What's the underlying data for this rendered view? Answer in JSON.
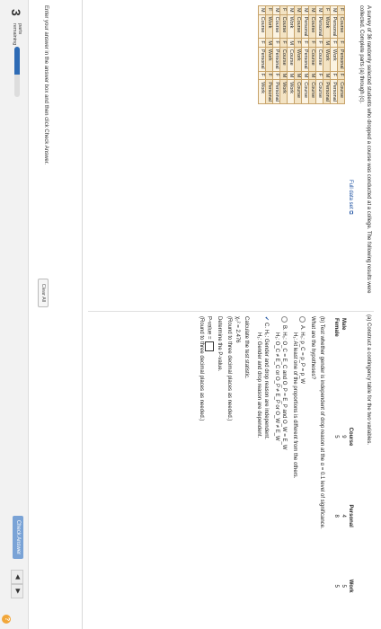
{
  "problem": {
    "intro": "A survey of 36 randomly selected students who dropped a course was conducted at a college. The following results were collected. Complete parts (a) through (c).",
    "full_data_label": "Full data set",
    "data_rows": [
      [
        "F",
        "Course",
        "F",
        "Personal",
        "F",
        "Course"
      ],
      [
        "M",
        "Personal",
        "F",
        "Work",
        "F",
        "Personal"
      ],
      [
        "F",
        "Work",
        "M",
        "Work",
        "M",
        "Personal"
      ],
      [
        "M",
        "Personal",
        "F",
        "Course",
        "F",
        "Course"
      ],
      [
        "M",
        "Course",
        "F",
        "Course",
        "M",
        "Course"
      ],
      [
        "M",
        "Personal",
        "F",
        "Personal",
        "M",
        "Course"
      ],
      [
        "M",
        "Course",
        "F",
        "Work",
        "M",
        "Course"
      ],
      [
        "M",
        "Work",
        "M",
        "Course",
        "M",
        "Work"
      ],
      [
        "F",
        "Course",
        "F",
        "Course",
        "M",
        "Work"
      ],
      [
        "M",
        "Course",
        "F",
        "Personal",
        "F",
        "Personal"
      ],
      [
        "F",
        "Work",
        "M",
        "Work",
        "F",
        "Personal"
      ],
      [
        "M",
        "Course",
        "F",
        "Personal",
        "F",
        "Work"
      ]
    ]
  },
  "part_a": {
    "prompt": "(a) Construct a contingency table for the two variables.",
    "columns": [
      "Course",
      "Personal",
      "Work"
    ],
    "rows": [
      {
        "label": "Male",
        "values": [
          "9",
          "4",
          "5"
        ]
      },
      {
        "label": "Female",
        "values": [
          "5",
          "8",
          "5"
        ]
      }
    ]
  },
  "part_b": {
    "prompt": "(b) Test whether gender is independent of drop reason at the α = 0.1 level of significance.",
    "question": "What are the hypotheses?",
    "options": [
      {
        "letter": "A.",
        "line1": "H₀: p_C = p_P = p_W",
        "line2": "H₁: At least one of the proportions is different from the others."
      },
      {
        "letter": "B.",
        "line1": "H₀: O_C = E_C and O_P = E_P and O_W = E_W",
        "line2": "H₁: O_C ≠ E_C or O_P ≠ E_P or O_W ≠ E_W"
      },
      {
        "letter": "C.",
        "line1": "H₀: Gender and drop reason are independent.",
        "line2": "H₁: Gender and drop reason are dependent."
      }
    ],
    "selected": "C.",
    "test_stat_label": "Calculate the test statistic.",
    "chi_value": "χ₀² = 2.476",
    "round_note_1": "(Round to three decimal places as needed.)",
    "pvalue_prompt": "Determine the P-value.",
    "pvalue_label": "P-value =",
    "round_note_2": "(Round to three decimal places as needed.)"
  },
  "footer": {
    "hint": "Enter your answer in the answer box and then click Check Answer.",
    "clear_all": "Clear All",
    "parts_count": "3",
    "parts_label_1": "parts",
    "parts_label_2": "remaining",
    "progress": 0.55,
    "check_answer": "Check Answer",
    "prev": "◀",
    "next": "▶",
    "help": "?"
  },
  "colors": {
    "accent": "#2e6bb5",
    "table_header": "#f3e3c3",
    "help": "#f2a73a"
  }
}
